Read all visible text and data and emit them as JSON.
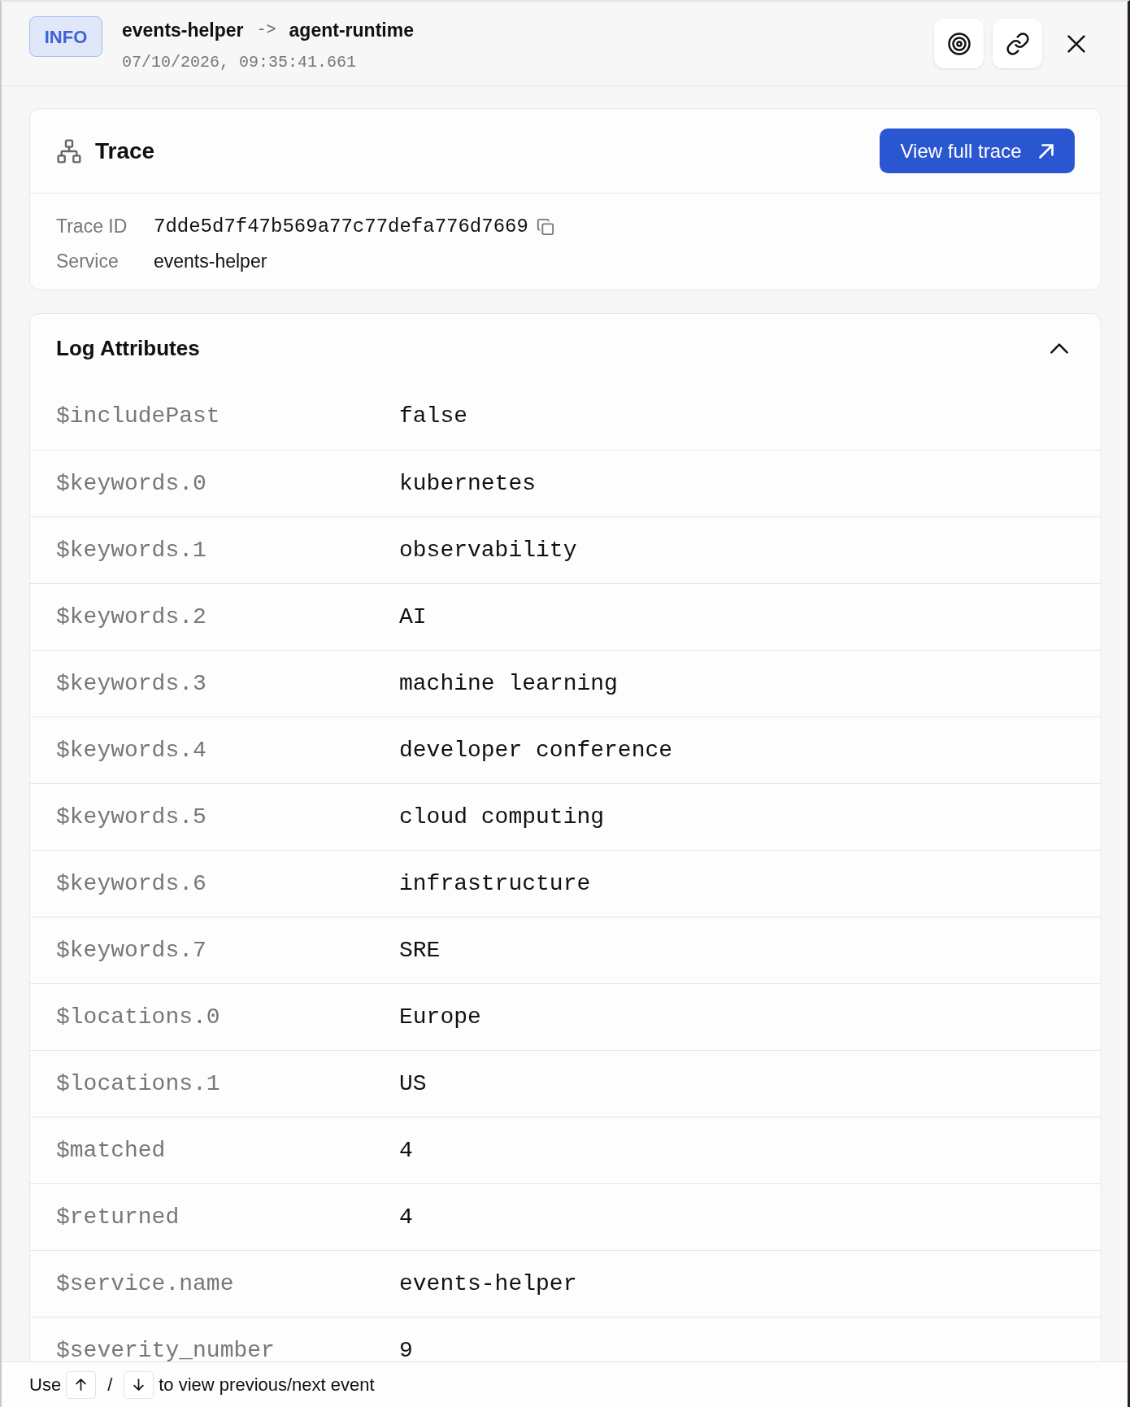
{
  "header": {
    "level_badge": "INFO",
    "source": "events-helper",
    "arrow": "->",
    "target": "agent-runtime",
    "timestamp": "07/10/2026, 09:35:41.661"
  },
  "trace": {
    "title": "Trace",
    "button": "View full trace",
    "fields": [
      {
        "kind": "id",
        "label": "Trace ID",
        "value": "7dde5d7f47b569a77c77defa776d7669"
      },
      {
        "kind": "text",
        "label": "Service",
        "value": "events-helper"
      }
    ]
  },
  "log_attributes": {
    "title": "Log Attributes",
    "expanded": true,
    "rows": [
      {
        "key": "$includePast",
        "value": "false"
      },
      {
        "key": "$keywords.0",
        "value": "kubernetes"
      },
      {
        "key": "$keywords.1",
        "value": "observability"
      },
      {
        "key": "$keywords.2",
        "value": "AI"
      },
      {
        "key": "$keywords.3",
        "value": "machine learning"
      },
      {
        "key": "$keywords.4",
        "value": "developer conference"
      },
      {
        "key": "$keywords.5",
        "value": "cloud computing"
      },
      {
        "key": "$keywords.6",
        "value": "infrastructure"
      },
      {
        "key": "$keywords.7",
        "value": "SRE"
      },
      {
        "key": "$locations.0",
        "value": "Europe"
      },
      {
        "key": "$locations.1",
        "value": "US"
      },
      {
        "key": "$matched",
        "value": "4"
      },
      {
        "key": "$returned",
        "value": "4"
      },
      {
        "key": "$service.name",
        "value": "events-helper"
      },
      {
        "key": "$severity_number",
        "value": "9"
      }
    ]
  },
  "footer": {
    "prefix": "Use",
    "separator": "/",
    "suffix": "to view previous/next event"
  }
}
